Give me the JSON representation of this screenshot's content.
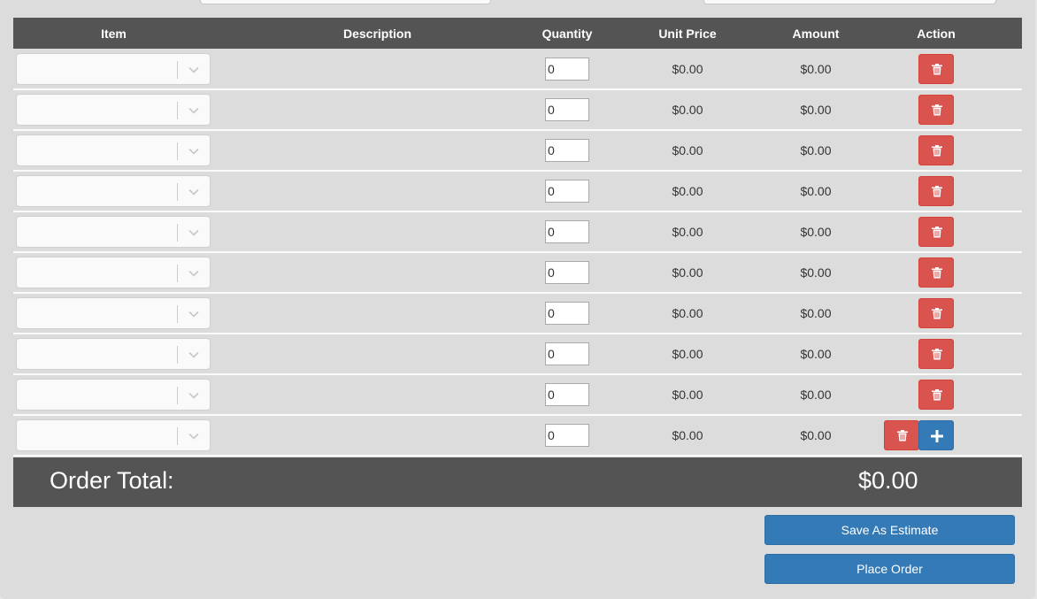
{
  "table": {
    "headers": {
      "item": "Item",
      "description": "Description",
      "quantity": "Quantity",
      "unit_price": "Unit Price",
      "amount": "Amount",
      "action": "Action"
    },
    "rows": [
      {
        "item": "",
        "description": "",
        "quantity": "0",
        "unit_price": "$0.00",
        "amount": "$0.00"
      },
      {
        "item": "",
        "description": "",
        "quantity": "0",
        "unit_price": "$0.00",
        "amount": "$0.00"
      },
      {
        "item": "",
        "description": "",
        "quantity": "0",
        "unit_price": "$0.00",
        "amount": "$0.00"
      },
      {
        "item": "",
        "description": "",
        "quantity": "0",
        "unit_price": "$0.00",
        "amount": "$0.00"
      },
      {
        "item": "",
        "description": "",
        "quantity": "0",
        "unit_price": "$0.00",
        "amount": "$0.00"
      },
      {
        "item": "",
        "description": "",
        "quantity": "0",
        "unit_price": "$0.00",
        "amount": "$0.00"
      },
      {
        "item": "",
        "description": "",
        "quantity": "0",
        "unit_price": "$0.00",
        "amount": "$0.00"
      },
      {
        "item": "",
        "description": "",
        "quantity": "0",
        "unit_price": "$0.00",
        "amount": "$0.00"
      },
      {
        "item": "",
        "description": "",
        "quantity": "0",
        "unit_price": "$0.00",
        "amount": "$0.00"
      },
      {
        "item": "",
        "description": "",
        "quantity": "0",
        "unit_price": "$0.00",
        "amount": "$0.00"
      }
    ]
  },
  "order_total": {
    "label": "Order Total:",
    "value": "$0.00"
  },
  "buttons": {
    "save_estimate": "Save As Estimate",
    "place_order": "Place Order"
  },
  "icons": {
    "delete": "trash-icon",
    "add": "plus-icon",
    "dropdown": "chevron-down-icon"
  },
  "colors": {
    "header_bg": "#545454",
    "delete_button": "#d9534f",
    "primary_button": "#337ab7",
    "panel_bg": "#dcdcdc"
  }
}
